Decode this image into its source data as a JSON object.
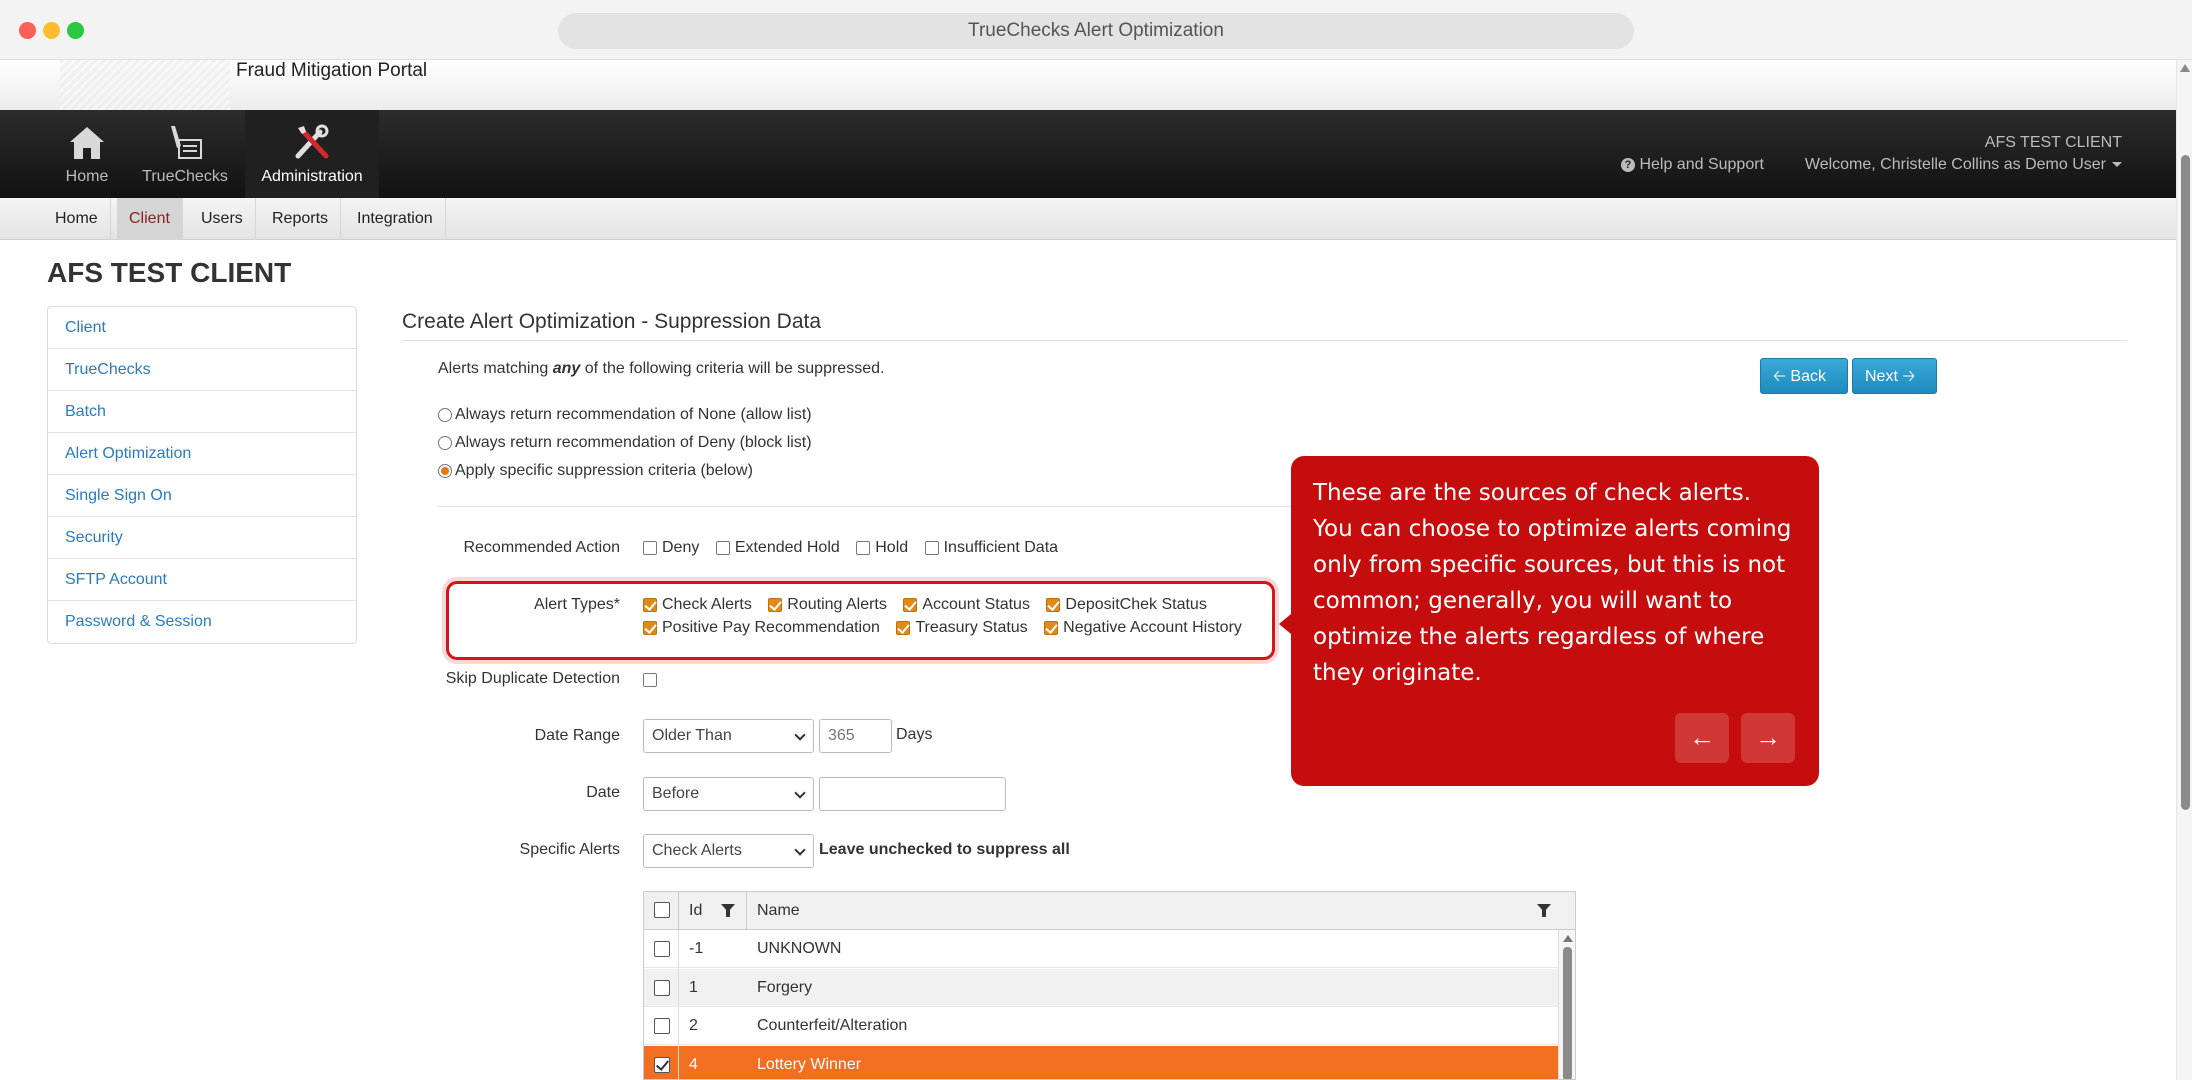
{
  "browser": {
    "title": "TrueChecks Alert Optimization"
  },
  "portal": {
    "title": "Fraud Mitigation Portal"
  },
  "nav": {
    "items": [
      {
        "label": "Home",
        "icon": "house-icon"
      },
      {
        "label": "TrueChecks",
        "icon": "check-pen-icon"
      },
      {
        "label": "Administration",
        "icon": "tools-icon"
      }
    ],
    "active": "Administration",
    "client_name": "AFS TEST CLIENT",
    "help": "Help and Support",
    "welcome": "Welcome, Christelle Collins as Demo User"
  },
  "subnav": {
    "items": [
      "Home",
      "Client",
      "Users",
      "Reports",
      "Integration"
    ],
    "active": "Client"
  },
  "page": {
    "heading": "AFS TEST CLIENT"
  },
  "sidebar": {
    "items": [
      "Client",
      "TrueChecks",
      "Batch",
      "Alert Optimization",
      "Single Sign On",
      "Security",
      "SFTP Account",
      "Password & Session"
    ]
  },
  "section": {
    "title": "Create Alert Optimization - Suppression Data",
    "intro_pre": "Alerts matching ",
    "intro_em": "any",
    "intro_post": " of the following criteria will be suppressed.",
    "back": "Back",
    "next": "Next"
  },
  "radios": [
    {
      "label": "Always return recommendation of None (allow list)",
      "selected": false
    },
    {
      "label": "Always return recommendation of Deny (block list)",
      "selected": false
    },
    {
      "label": "Apply specific suppression criteria (below)",
      "selected": true
    }
  ],
  "form": {
    "recommended_action": {
      "label": "Recommended Action",
      "options": [
        "Deny",
        "Extended Hold",
        "Hold",
        "Insufficient Data"
      ]
    },
    "alert_types": {
      "label": "Alert Types*",
      "row1": [
        "Check Alerts",
        "Routing Alerts",
        "Account Status",
        "DepositChek Status"
      ],
      "row2": [
        "Positive Pay Recommendation",
        "Treasury Status",
        "Negative Account History"
      ]
    },
    "skip_duplicate": {
      "label": "Skip Duplicate Detection"
    },
    "date_range": {
      "label": "Date Range",
      "select": "Older Than",
      "value": "365",
      "unit": "Days"
    },
    "date": {
      "label": "Date",
      "select": "Before",
      "value": ""
    },
    "specific_alerts": {
      "label": "Specific Alerts",
      "select": "Check Alerts",
      "hint": "Leave unchecked to suppress all"
    }
  },
  "grid": {
    "headers": {
      "id": "Id",
      "name": "Name"
    },
    "rows": [
      {
        "id": "-1",
        "name": "UNKNOWN",
        "checked": false
      },
      {
        "id": "1",
        "name": "Forgery",
        "checked": false
      },
      {
        "id": "2",
        "name": "Counterfeit/Alteration",
        "checked": false
      },
      {
        "id": "4",
        "name": "Lottery Winner",
        "checked": true
      }
    ]
  },
  "tooltip": {
    "text": "These are the sources of check alerts. You can choose to optimize alerts coming only from specific sources, but this is not common; generally, you will want to optimize the alerts regardless of where they originate.",
    "prev": "←",
    "next": "→"
  },
  "colors": {
    "brand_red": "#c60d0d",
    "accent_orange": "#f26f21",
    "link_blue": "#2a7bbf",
    "button_blue": "#2a9ccc"
  }
}
